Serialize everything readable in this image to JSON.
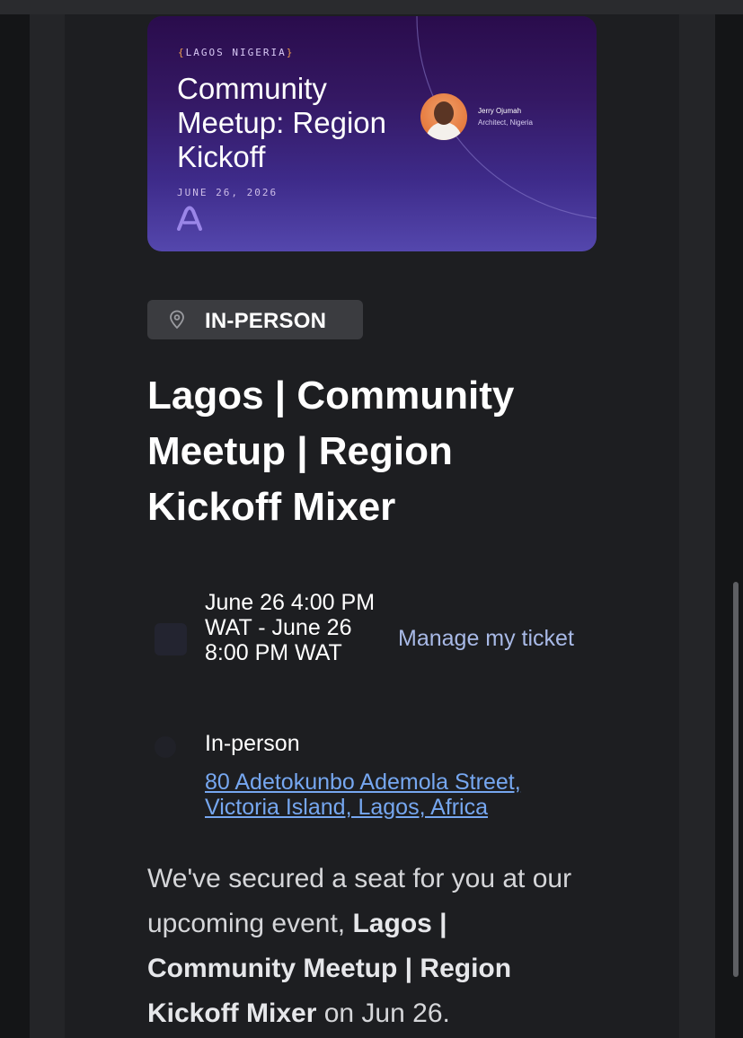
{
  "banner": {
    "location_tag": "LAGOS NIGERIA",
    "title": "Community Meetup: Region Kickoff",
    "date": "JUNE 26, 2026",
    "speaker_name": "Jerry Ojumah",
    "speaker_role": "Architect, Nigeria"
  },
  "badge": {
    "label": "IN-PERSON",
    "icon": "map-pin-icon"
  },
  "event": {
    "title": "Lagos | Community Meetup | Region Kickoff Mixer"
  },
  "datetime": {
    "range": "June 26 4:00 PM WAT - June 26 8:00 PM WAT",
    "manage_link": "Manage my ticket"
  },
  "location": {
    "type": "In-person",
    "address": "80 Adetokunbo Ademola Street, Victoria Island, Lagos, Africa"
  },
  "message": {
    "prefix": "We've secured a seat for you at our upcoming event, ",
    "event_name": "Lagos | Community Meetup | Region Kickoff Mixer",
    "suffix": " on Jun 26."
  },
  "colors": {
    "background": "#1d1e21",
    "link": "#76a7f0",
    "manage_link": "#a8b9e6",
    "badge_bg": "#3b3c40",
    "banner_top": "#2a0c4c",
    "banner_bottom": "#5447ad"
  }
}
